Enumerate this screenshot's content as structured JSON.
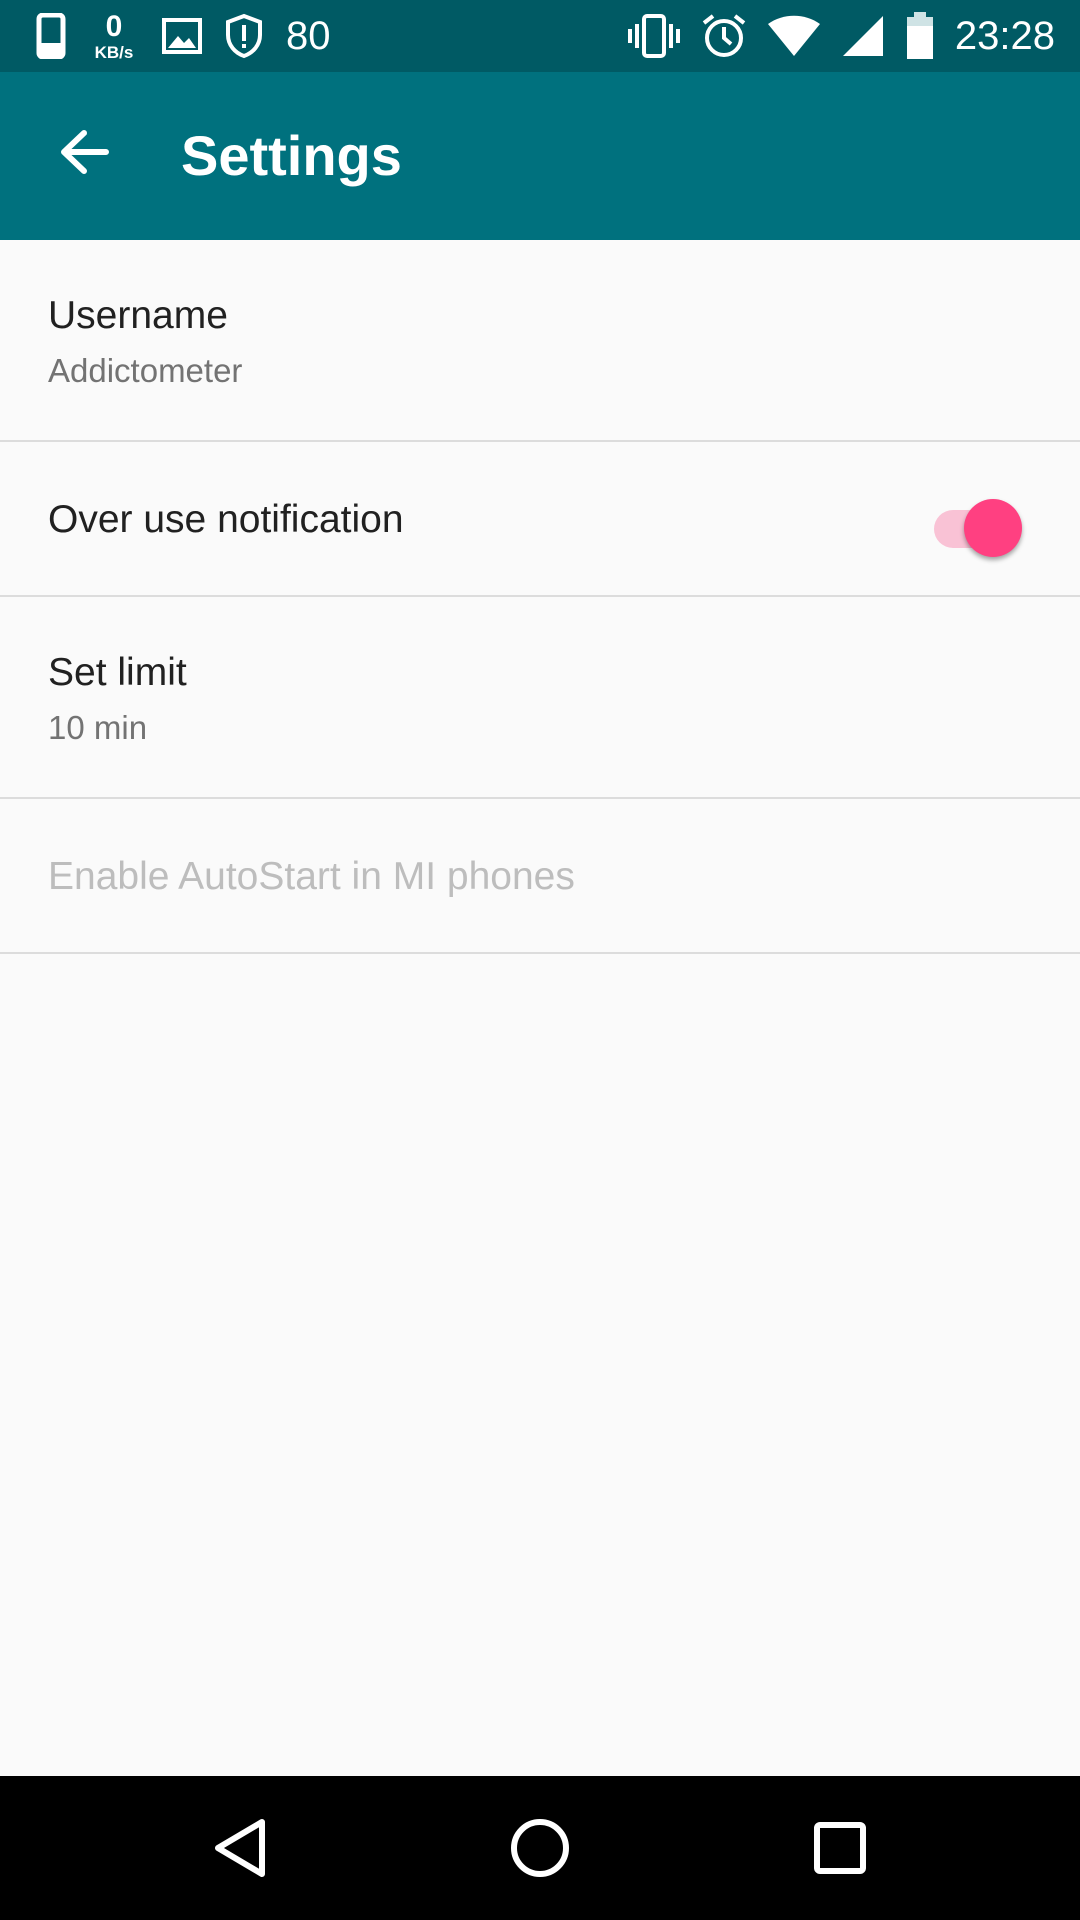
{
  "status_bar": {
    "left_icons": [
      "phone-icon",
      "image-icon",
      "shield-icon"
    ],
    "speed_value": "0",
    "speed_unit": "KB/s",
    "notif_count": "80",
    "right_icons": [
      "vibrate-icon",
      "alarm-icon",
      "wifi-icon",
      "signal-icon",
      "battery-icon"
    ],
    "time": "23:28"
  },
  "app_bar": {
    "back_icon": "arrow-back-icon",
    "title": "Settings",
    "background": "#00717e"
  },
  "preferences": [
    {
      "title": "Username",
      "summary": "Addictometer"
    },
    {
      "title": "Over use notification",
      "switch_on": true
    },
    {
      "title": "Set limit",
      "summary": "10 min"
    },
    {
      "title": "Enable AutoStart in MI phones",
      "enabled": false
    }
  ],
  "colors": {
    "status_bar": "#005a64",
    "accent": "#ff4081",
    "switch_track": "#f9c2d5"
  },
  "nav_bar": {
    "icons": [
      "back-triangle-icon",
      "home-circle-icon",
      "recents-square-icon"
    ]
  }
}
